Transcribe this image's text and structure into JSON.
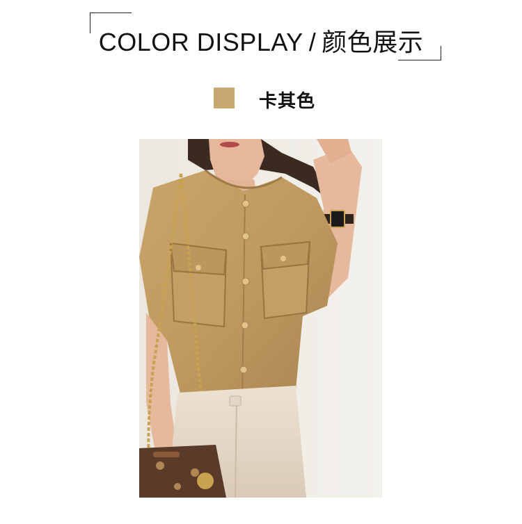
{
  "header": {
    "title_en": "COLOR DISPLAY",
    "separator": "/",
    "title_cn": "颜色展示"
  },
  "swatch": {
    "color": "#c8a771",
    "label": "卡其色"
  },
  "photo": {
    "description_icon": "model-photo"
  }
}
